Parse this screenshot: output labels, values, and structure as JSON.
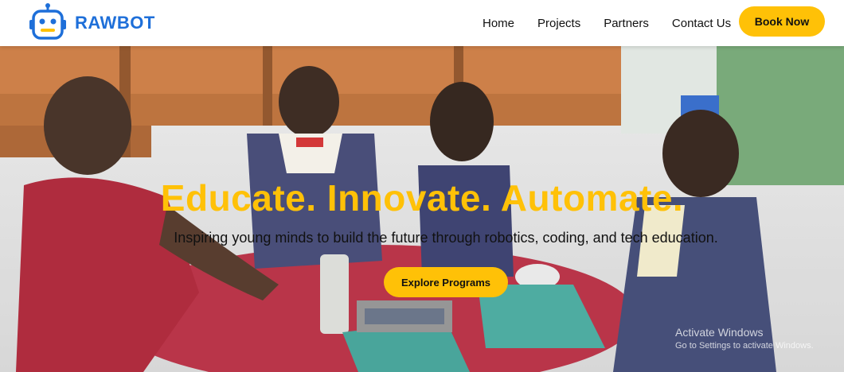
{
  "brand": {
    "name": "RAWBOT",
    "logo_icon": "robot-head-icon",
    "color": "#1e6fd9"
  },
  "nav": {
    "items": [
      {
        "label": "Home"
      },
      {
        "label": "Projects"
      },
      {
        "label": "Partners"
      },
      {
        "label": "Contact Us"
      }
    ],
    "cta_label": "Book Now"
  },
  "hero": {
    "title": "Educate. Innovate. Automate.",
    "subtitle": "Inspiring young minds to build the future through robotics, coding, and tech education.",
    "cta_label": "Explore Programs",
    "image": "children-robotics-classroom-photo"
  },
  "watermark": {
    "title": "Activate Windows",
    "subtitle": "Go to Settings to activate Windows."
  },
  "colors": {
    "accent": "#ffc107",
    "brand": "#1e6fd9",
    "nav_bg": "#ffffff"
  }
}
